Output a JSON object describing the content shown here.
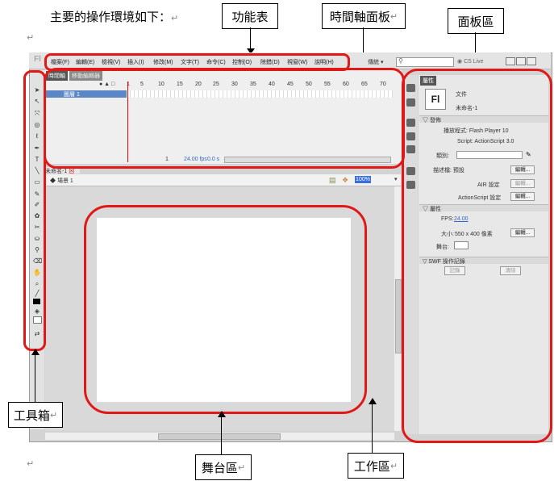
{
  "doc": {
    "heading": "主要的操作環境如下：",
    "para_mark": "↵"
  },
  "callouts": {
    "menu": "功能表",
    "timeline": "時間軸面板",
    "panel": "面板區",
    "toolbox": "工具箱",
    "stage": "舞台區",
    "work": "工作區"
  },
  "app": {
    "logo": "Fl",
    "menu": [
      "檔案(F)",
      "編輯(E)",
      "檢視(V)",
      "插入(I)",
      "修改(M)",
      "文字(T)",
      "命令(C)",
      "控制(O)",
      "除錯(D)",
      "視窗(W)",
      "說明(H)"
    ],
    "workspace": "傳統",
    "workspace_arrow": "▾",
    "search_icon": "search-icon",
    "search_value": "",
    "cslive": "CS Live",
    "timeline_tabs": [
      "時間軸",
      "移動編輯器"
    ],
    "frame_numbers": [
      "1",
      "5",
      "10",
      "15",
      "20",
      "25",
      "30",
      "35",
      "40",
      "45",
      "50",
      "55",
      "60",
      "65",
      "70"
    ],
    "layer_name": "圖層 1",
    "timeline_status": {
      "frame": "1",
      "fps": "24.00 fps",
      "time": "0.0 s"
    },
    "doc_tab": "未命名-1",
    "scene_label": "場景 1",
    "zoom": "100%",
    "properties": {
      "tab": "屬性",
      "doc_type": "文件",
      "doc_name": "未命名-1",
      "fl_icon_text": "Fl",
      "publish_section": "發佈",
      "player": "播放程式: Flash Player 10",
      "script": "Script: ActionScript 3.0",
      "class_label": "類別:",
      "profile_label": "描述檔: 預設",
      "edit_button": "編輯...",
      "air_label": "AIR 設定",
      "as_label": "ActionScript 設定",
      "props_section": "屬性",
      "fps_label": "FPS:",
      "fps_value": "24.00",
      "size_label": "大小:",
      "size_value": "550 x 400 像素",
      "stage_label": "舞台:",
      "swf_section": "SWF 操作記錄",
      "log_button": "記錄",
      "clear_button": "清除"
    }
  }
}
